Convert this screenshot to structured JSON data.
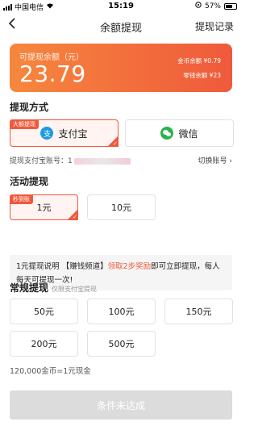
{
  "statusbar": {
    "carrier": "中国电信",
    "time": "15:19",
    "battery": "57%"
  },
  "header": {
    "title": "余额提现",
    "record": "提现记录",
    "back_icon": "chevron-left-icon"
  },
  "balance": {
    "label": "可提现余额（元）",
    "amount": "23.79",
    "coin_label": "金币余额 ¥0.79",
    "change_label": "零钱余额 ¥23"
  },
  "method_section": {
    "title": "提现方式",
    "alipay": {
      "label": "支付宝",
      "tag": "大额提现",
      "selected": true
    },
    "wechat": {
      "label": "微信",
      "selected": false
    },
    "account_label": "提现支付宝账号：",
    "account_value_visible": "1",
    "switch_label": "切换账号"
  },
  "activity_section": {
    "title": "活动提现",
    "options": [
      {
        "label": "1元",
        "tag": "秒到账",
        "selected": true
      },
      {
        "label": "10元",
        "selected": false
      }
    ]
  },
  "info": {
    "prefix": "1元提现说明 【赚钱频道】",
    "highlight": "领取2步奖励",
    "suffix": "即可立即提现，每人每天可提现一次!"
  },
  "regular_section": {
    "title": "常规提现",
    "hint": "仅限支付宝提现",
    "options": [
      "50元",
      "100元",
      "150元",
      "200元",
      "500元"
    ]
  },
  "rate_text": "120,000金币=1元现金",
  "submit_label": "条件未达成",
  "colors": {
    "accent": "#ef5a3c",
    "gradient_start": "#f6873d",
    "alipay_blue": "#1b9be0",
    "wechat_green": "#2ab24d",
    "disabled_button": "#dcdcdc"
  }
}
